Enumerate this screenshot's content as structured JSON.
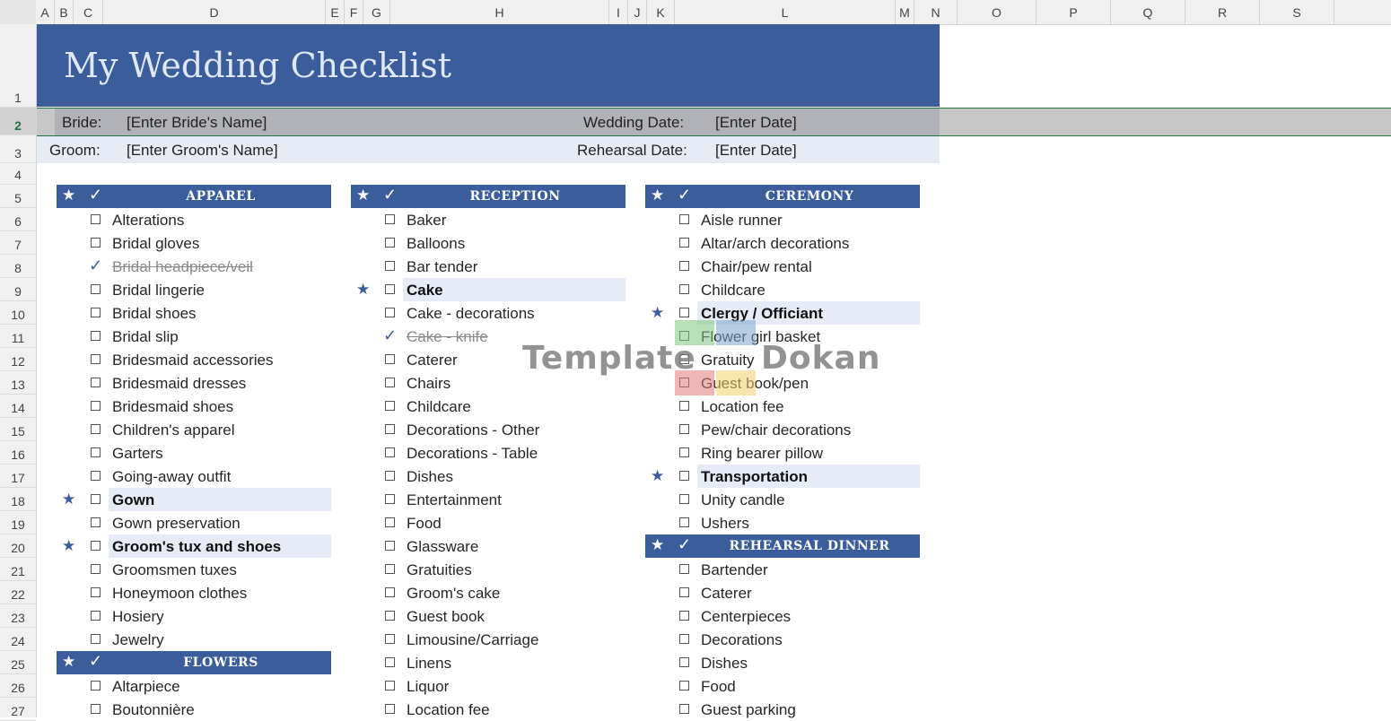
{
  "columns": [
    "A",
    "B",
    "C",
    "D",
    "E",
    "F",
    "G",
    "H",
    "I",
    "J",
    "K",
    "L",
    "M",
    "N",
    "O",
    "P",
    "Q",
    "R",
    "S"
  ],
  "rows": [
    "1",
    "2",
    "3",
    "4",
    "5",
    "6",
    "7",
    "8",
    "9",
    "10",
    "11",
    "12",
    "13",
    "14",
    "15",
    "16",
    "17",
    "18",
    "19",
    "20",
    "21",
    "22",
    "23",
    "24",
    "25",
    "26",
    "27"
  ],
  "title": "My Wedding Checklist",
  "bride": {
    "label": "Bride:",
    "value": "[Enter Bride's Name]"
  },
  "groom": {
    "label": "Groom:",
    "value": "[Enter Groom's Name]"
  },
  "wedding_date": {
    "label": "Wedding Date:",
    "value": "[Enter Date]"
  },
  "rehearsal_date": {
    "label": "Rehearsal Date:",
    "value": "[Enter Date]"
  },
  "header_icons": {
    "star": "★",
    "check": "✓"
  },
  "watermark": {
    "left": "Template",
    "right": "Dokan",
    "colors": [
      "#7dc47d",
      "#7aa4cc",
      "#e07a7a",
      "#f0cf6a"
    ]
  },
  "colors": {
    "accent": "#3b5d9c",
    "highlight": "#e6ebf5",
    "selection": "#217346"
  },
  "apparel": {
    "title": "APPAREL",
    "items": [
      {
        "text": "Alterations"
      },
      {
        "text": "Bridal gloves"
      },
      {
        "text": "Bridal headpiece/veil",
        "done": true
      },
      {
        "text": "Bridal lingerie"
      },
      {
        "text": "Bridal shoes"
      },
      {
        "text": "Bridal slip"
      },
      {
        "text": "Bridesmaid accessories"
      },
      {
        "text": "Bridesmaid dresses"
      },
      {
        "text": "Bridesmaid shoes"
      },
      {
        "text": "Children's apparel"
      },
      {
        "text": "Garters"
      },
      {
        "text": "Going-away outfit"
      },
      {
        "text": "Gown",
        "starred": true
      },
      {
        "text": "Gown preservation"
      },
      {
        "text": "Groom's tux and shoes",
        "starred": true
      },
      {
        "text": "Groomsmen tuxes"
      },
      {
        "text": "Honeymoon clothes"
      },
      {
        "text": "Hosiery"
      },
      {
        "text": "Jewelry"
      }
    ]
  },
  "flowers": {
    "title": "FLOWERS",
    "items": [
      {
        "text": "Altarpiece"
      },
      {
        "text": "Boutonnière"
      }
    ]
  },
  "reception": {
    "title": "RECEPTION",
    "items": [
      {
        "text": "Baker"
      },
      {
        "text": "Balloons"
      },
      {
        "text": "Bar tender"
      },
      {
        "text": "Cake",
        "starred": true
      },
      {
        "text": "Cake - decorations"
      },
      {
        "text": "Cake - knife",
        "done": true
      },
      {
        "text": "Caterer"
      },
      {
        "text": "Chairs"
      },
      {
        "text": "Childcare"
      },
      {
        "text": "Decorations - Other"
      },
      {
        "text": "Decorations - Table"
      },
      {
        "text": "Dishes"
      },
      {
        "text": "Entertainment"
      },
      {
        "text": "Food"
      },
      {
        "text": "Glassware"
      },
      {
        "text": "Gratuities"
      },
      {
        "text": "Groom's cake"
      },
      {
        "text": "Guest book"
      },
      {
        "text": "Limousine/Carriage"
      },
      {
        "text": "Linens"
      },
      {
        "text": "Liquor"
      },
      {
        "text": "Location fee"
      }
    ]
  },
  "ceremony": {
    "title": "CEREMONY",
    "items": [
      {
        "text": "Aisle runner"
      },
      {
        "text": "Altar/arch decorations"
      },
      {
        "text": "Chair/pew rental"
      },
      {
        "text": "Childcare"
      },
      {
        "text": "Clergy / Officiant",
        "starred": true
      },
      {
        "text": "Flower girl basket"
      },
      {
        "text": "Gratuity"
      },
      {
        "text": "Guest book/pen"
      },
      {
        "text": "Location fee"
      },
      {
        "text": "Pew/chair decorations"
      },
      {
        "text": "Ring bearer pillow"
      },
      {
        "text": "Transportation",
        "starred": true
      },
      {
        "text": "Unity candle"
      },
      {
        "text": "Ushers"
      }
    ]
  },
  "rehearsal": {
    "title": "REHEARSAL DINNER",
    "items": [
      {
        "text": "Bartender"
      },
      {
        "text": "Caterer"
      },
      {
        "text": "Centerpieces"
      },
      {
        "text": "Decorations"
      },
      {
        "text": "Dishes"
      },
      {
        "text": "Food"
      },
      {
        "text": "Guest parking"
      }
    ]
  }
}
